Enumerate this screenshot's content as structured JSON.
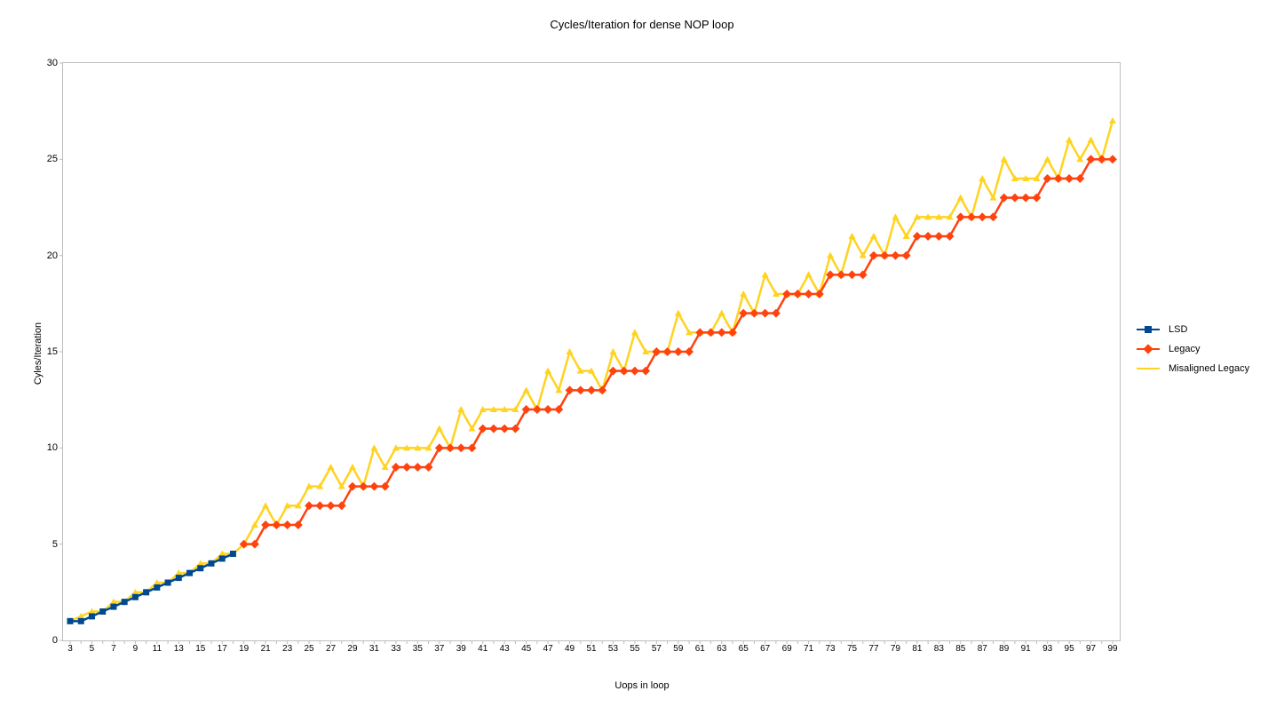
{
  "chart_data": {
    "type": "line",
    "title": "Cycles/Iteration for dense NOP loop",
    "xlabel": "Uops in loop",
    "ylabel": "Cyles/Iteration",
    "ylim": [
      0,
      30
    ],
    "yticks": [
      0,
      5,
      10,
      15,
      20,
      25,
      30
    ],
    "categories": [
      3,
      4,
      5,
      6,
      7,
      8,
      9,
      10,
      11,
      12,
      13,
      14,
      15,
      16,
      17,
      18,
      19,
      20,
      21,
      22,
      23,
      24,
      25,
      26,
      27,
      28,
      29,
      30,
      31,
      32,
      33,
      34,
      35,
      36,
      37,
      38,
      39,
      40,
      41,
      42,
      43,
      44,
      45,
      46,
      47,
      48,
      49,
      50,
      51,
      52,
      53,
      54,
      55,
      56,
      57,
      58,
      59,
      60,
      61,
      62,
      63,
      64,
      65,
      66,
      67,
      68,
      69,
      70,
      71,
      72,
      73,
      74,
      75,
      76,
      77,
      78,
      79,
      80,
      81,
      82,
      83,
      84,
      85,
      86,
      87,
      88,
      89,
      90,
      91,
      92,
      93,
      94,
      95,
      96,
      97,
      98,
      99
    ],
    "series": [
      {
        "name": "LSD",
        "color": "#004990",
        "marker": "square",
        "values": [
          1,
          1,
          1.25,
          1.5,
          1.75,
          2,
          2.25,
          2.5,
          2.75,
          3,
          3.25,
          3.5,
          3.75,
          4,
          4.25,
          4.5,
          null,
          null,
          null,
          null,
          null,
          null,
          null,
          null,
          null,
          null,
          null,
          null,
          null,
          null,
          null,
          null,
          null,
          null,
          null,
          null,
          null,
          null,
          null,
          null,
          null,
          null,
          null,
          null,
          null,
          null,
          null,
          null,
          null,
          null,
          null,
          null,
          null,
          null,
          null,
          null,
          null,
          null,
          null,
          null,
          null,
          null,
          null,
          null,
          null,
          null,
          null,
          null,
          null,
          null,
          null,
          null,
          null,
          null,
          null,
          null,
          null,
          null,
          null,
          null,
          null,
          null,
          null,
          null,
          null,
          null,
          null,
          null,
          null,
          null,
          null,
          null,
          null,
          null,
          null,
          null,
          null
        ]
      },
      {
        "name": "Legacy",
        "color": "#ff420e",
        "marker": "diamond",
        "values": [
          null,
          null,
          null,
          null,
          null,
          null,
          null,
          null,
          null,
          null,
          null,
          null,
          null,
          null,
          null,
          null,
          5,
          5,
          6,
          6,
          6,
          6,
          7,
          7,
          7,
          7,
          8,
          8,
          8,
          8,
          9,
          9,
          9,
          9,
          10,
          10,
          10,
          10,
          11,
          11,
          11,
          11,
          12,
          12,
          12,
          12,
          13,
          13,
          13,
          13,
          14,
          14,
          14,
          14,
          15,
          15,
          15,
          15,
          16,
          16,
          16,
          16,
          17,
          17,
          17,
          17,
          18,
          18,
          18,
          18,
          19,
          19,
          19,
          19,
          20,
          20,
          20,
          20,
          21,
          21,
          21,
          21,
          22,
          22,
          22,
          22,
          23,
          23,
          23,
          23,
          24,
          24,
          24,
          24,
          25,
          25,
          25
        ]
      },
      {
        "name": "Misaligned Legacy",
        "color": "#ffd320",
        "marker": "triangle",
        "values": [
          1,
          1.25,
          1.5,
          1.5,
          2,
          2,
          2.5,
          2.5,
          3,
          3,
          3.5,
          3.5,
          4,
          4,
          4.5,
          4.5,
          5,
          6,
          7,
          6,
          7,
          7,
          8,
          8,
          9,
          8,
          9,
          8,
          10,
          9,
          10,
          10,
          10,
          10,
          11,
          10,
          12,
          11,
          12,
          12,
          12,
          12,
          13,
          12,
          14,
          13,
          15,
          14,
          14,
          13,
          15,
          14,
          16,
          15,
          15,
          15,
          17,
          16,
          16,
          16,
          17,
          16,
          18,
          17,
          19,
          18,
          18,
          18,
          19,
          18,
          20,
          19,
          21,
          20,
          21,
          20,
          22,
          21,
          22,
          22,
          22,
          22,
          23,
          22,
          24,
          23,
          25,
          24,
          24,
          24,
          25,
          24,
          26,
          25,
          26,
          25,
          27
        ]
      }
    ],
    "legend_position": "right"
  }
}
